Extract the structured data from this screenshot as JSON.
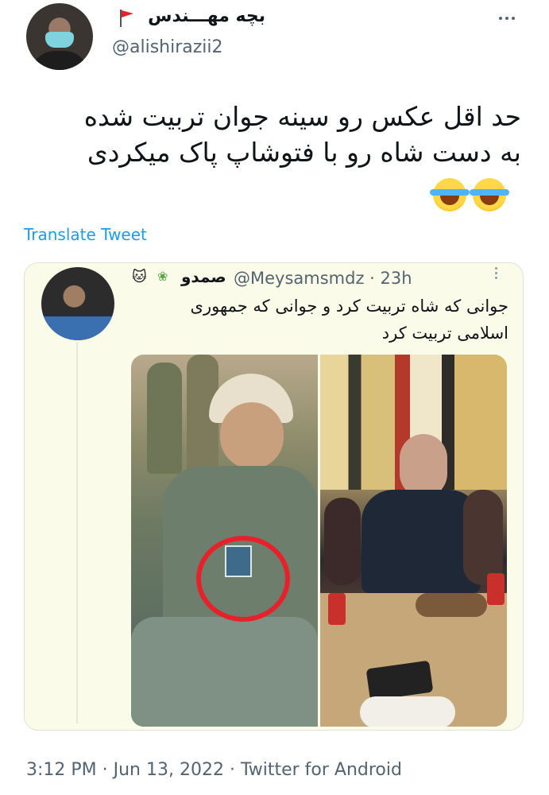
{
  "author": {
    "display_name": "بچه مهـــندس",
    "handle": "@alishirazii2",
    "flag_icon": "red-flag-icon",
    "more_icon": "more-options-icon"
  },
  "tweet": {
    "text": "حد اقل عکس رو سینه جوان تربیت شده\nبه دست شاه رو با فتوشاپ پاک میکردی",
    "emojis": [
      "face-with-tears-of-joy",
      "face-with-tears-of-joy"
    ],
    "translate_label": "Translate Tweet"
  },
  "quoted": {
    "display_name": "صمدو",
    "handle_time": "@Meysamsmdz · 23h",
    "text": "جوانی که شاه تربیت کرد و جوانی که جمهوری\nاسلامی تربیت کرد",
    "emoji_1": "🐱",
    "emoji_2": "❀"
  },
  "footer": {
    "meta": "3:12 PM · Jun 13, 2022 · Twitter for Android"
  },
  "colors": {
    "link": "#1d9bf0",
    "secondary_text": "#536471",
    "quote_background": "#fbfbe9",
    "circle_highlight": "#e8202a"
  }
}
